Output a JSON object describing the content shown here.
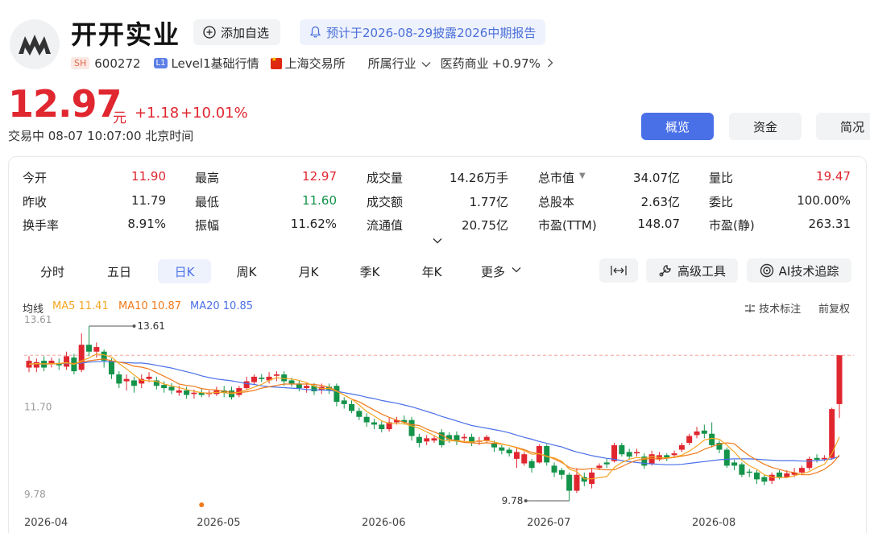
{
  "header": {
    "name": "开开实业",
    "add_watch": "添加自选",
    "notice": "预计于2026-08-29披露2026中期报告",
    "exchange_tag": "SH",
    "code": "600272",
    "level_tag": "L1",
    "level": "Level1基础行情",
    "exchange": "上海交易所",
    "industry_label": "所属行业",
    "industry": "医药商业",
    "industry_change": "+0.97%"
  },
  "quote": {
    "price": "12.97",
    "unit": "元",
    "change": "+1.18",
    "change_pct": "+10.01%",
    "status": "交易中 08-07 10:07:00 北京时间"
  },
  "top_tabs": [
    "概览",
    "资金",
    "简况"
  ],
  "stats": [
    [
      {
        "label": "今开",
        "value": "11.90",
        "color": "red"
      },
      {
        "label": "昨收",
        "value": "11.79",
        "color": ""
      },
      {
        "label": "换手率",
        "value": "8.91%",
        "color": ""
      }
    ],
    [
      {
        "label": "最高",
        "value": "12.97",
        "color": "red"
      },
      {
        "label": "最低",
        "value": "11.60",
        "color": "green"
      },
      {
        "label": "振幅",
        "value": "11.62%",
        "color": ""
      }
    ],
    [
      {
        "label": "成交量",
        "value": "14.26万手",
        "color": ""
      },
      {
        "label": "成交额",
        "value": "1.77亿",
        "color": ""
      },
      {
        "label": "流通值",
        "value": "20.75亿",
        "color": ""
      }
    ],
    [
      {
        "label": "总市值",
        "value": "34.07亿",
        "color": ""
      },
      {
        "label": "总股本",
        "value": "2.63亿",
        "color": ""
      },
      {
        "label": "市盈(TTM)",
        "value": "148.07",
        "color": ""
      }
    ],
    [
      {
        "label": "量比",
        "value": "19.47",
        "color": "red"
      },
      {
        "label": "委比",
        "value": "100.00%",
        "color": ""
      },
      {
        "label": "市盈(静)",
        "value": "263.31",
        "color": ""
      }
    ]
  ],
  "k_tabs": [
    "分时",
    "五日",
    "日K",
    "周K",
    "月K",
    "季K",
    "年K",
    "更多"
  ],
  "tools": {
    "fit": "",
    "advanced": "高级工具",
    "ai": "AI技术追踪"
  },
  "ma_legend": {
    "title": "均线",
    "ma5": "MA5 11.41",
    "ma10": "MA10 10.87",
    "ma20": "MA20 10.85"
  },
  "chart_options": {
    "annotate": "技术标注",
    "adjust": "前复权"
  },
  "colors": {
    "up": "#e0262f",
    "down": "#14934a",
    "ma5": "#f5a623",
    "ma10": "#f07a1a",
    "ma20": "#4a70e8",
    "accent": "#4a70e8"
  },
  "chart_data": {
    "type": "candlestick",
    "y_ticks": [
      "13.61",
      "11.70",
      "9.78"
    ],
    "ylim": [
      9.78,
      13.61
    ],
    "high_label": "13.61",
    "low_label": "9.78",
    "last_close_ref": 12.97,
    "x_ticks": [
      "2026-04",
      "2026-05",
      "2026-06",
      "2026-07",
      "2026-08"
    ],
    "candles": [
      [
        12.7,
        12.85,
        12.95,
        12.6
      ],
      [
        12.7,
        12.82,
        12.9,
        12.6
      ],
      [
        12.85,
        12.7,
        12.95,
        12.62
      ],
      [
        12.78,
        12.85,
        12.92,
        12.7
      ],
      [
        12.8,
        12.75,
        12.9,
        12.65
      ],
      [
        12.72,
        12.95,
        13.05,
        12.65
      ],
      [
        12.92,
        12.62,
        13.0,
        12.55
      ],
      [
        12.65,
        13.2,
        13.45,
        12.6
      ],
      [
        13.2,
        13.05,
        13.61,
        12.95
      ],
      [
        13.05,
        13.15,
        13.25,
        12.92
      ],
      [
        13.05,
        12.85,
        13.1,
        12.7
      ],
      [
        12.85,
        12.55,
        12.9,
        12.45
      ],
      [
        12.55,
        12.35,
        12.62,
        12.25
      ],
      [
        12.4,
        12.45,
        12.55,
        12.2
      ],
      [
        12.42,
        12.3,
        12.5,
        12.15
      ],
      [
        12.35,
        12.45,
        12.55,
        12.25
      ],
      [
        12.45,
        12.5,
        12.6,
        12.38
      ],
      [
        12.42,
        12.3,
        12.5,
        12.22
      ],
      [
        12.32,
        12.25,
        12.4,
        12.15
      ],
      [
        12.28,
        12.2,
        12.36,
        12.12
      ],
      [
        12.15,
        12.2,
        12.3,
        12.08
      ],
      [
        12.2,
        12.1,
        12.28,
        12.02
      ],
      [
        12.12,
        12.15,
        12.22,
        12.02
      ],
      [
        12.15,
        12.1,
        12.25,
        12.05
      ],
      [
        12.12,
        12.15,
        12.2,
        12.05
      ],
      [
        12.12,
        12.2,
        12.28,
        12.08
      ],
      [
        12.2,
        12.15,
        12.3,
        12.05
      ],
      [
        12.2,
        12.05,
        12.28,
        12.0
      ],
      [
        12.1,
        12.25,
        12.3,
        12.05
      ],
      [
        12.25,
        12.4,
        12.5,
        12.2
      ],
      [
        12.38,
        12.5,
        12.55,
        12.32
      ],
      [
        12.48,
        12.45,
        12.56,
        12.38
      ],
      [
        12.42,
        12.5,
        12.6,
        12.35
      ],
      [
        12.52,
        12.55,
        12.62,
        12.4
      ],
      [
        12.55,
        12.4,
        12.62,
        12.3
      ],
      [
        12.42,
        12.35,
        12.48,
        12.28
      ],
      [
        12.35,
        12.25,
        12.42,
        12.18
      ],
      [
        12.25,
        12.3,
        12.38,
        12.15
      ],
      [
        12.3,
        12.18,
        12.36,
        12.1
      ],
      [
        12.2,
        12.28,
        12.35,
        12.12
      ],
      [
        12.28,
        12.2,
        12.35,
        12.12
      ],
      [
        12.3,
        11.95,
        12.35,
        11.85
      ],
      [
        11.98,
        11.9,
        12.05,
        11.8
      ],
      [
        11.9,
        11.75,
        11.98,
        11.7
      ],
      [
        11.75,
        11.62,
        11.82,
        11.55
      ],
      [
        11.62,
        11.5,
        11.7,
        11.4
      ],
      [
        11.5,
        11.45,
        11.58,
        11.35
      ],
      [
        11.45,
        11.35,
        11.52,
        11.28
      ],
      [
        11.35,
        11.5,
        11.6,
        11.3
      ],
      [
        11.5,
        11.55,
        11.62,
        11.45
      ],
      [
        11.55,
        11.5,
        11.65,
        11.45
      ],
      [
        11.55,
        11.2,
        11.62,
        11.1
      ],
      [
        11.18,
        11.05,
        11.25,
        10.95
      ],
      [
        11.08,
        11.15,
        11.22,
        11.0
      ],
      [
        11.1,
        11.15,
        11.2,
        11.05
      ],
      [
        11.28,
        11.0,
        11.35,
        10.95
      ],
      [
        11.22,
        11.12,
        11.28,
        11.05
      ],
      [
        11.22,
        11.08,
        11.3,
        11.0
      ],
      [
        11.15,
        11.18,
        11.25,
        11.08
      ],
      [
        11.18,
        11.05,
        11.25,
        10.98
      ],
      [
        11.08,
        11.1,
        11.18,
        11.0
      ],
      [
        11.1,
        11.18,
        11.22,
        11.05
      ],
      [
        11.05,
        10.95,
        11.1,
        10.85
      ],
      [
        10.95,
        10.88,
        11.0,
        10.8
      ],
      [
        10.9,
        10.82,
        10.95,
        10.75
      ],
      [
        10.7,
        10.85,
        10.95,
        10.5
      ],
      [
        10.6,
        10.8,
        10.85,
        10.55
      ],
      [
        10.65,
        10.5,
        10.7,
        10.4
      ],
      [
        10.62,
        10.98,
        11.02,
        10.6
      ],
      [
        10.98,
        10.62,
        11.02,
        10.55
      ],
      [
        10.55,
        10.4,
        10.62,
        10.3
      ],
      [
        10.45,
        10.35,
        10.5,
        10.25
      ],
      [
        10.35,
        10.0,
        10.4,
        9.78
      ],
      [
        10.0,
        10.35,
        10.5,
        9.95
      ],
      [
        10.3,
        10.2,
        10.4,
        10.1
      ],
      [
        10.15,
        10.4,
        10.5,
        10.05
      ],
      [
        10.5,
        10.55,
        10.6,
        10.45
      ],
      [
        10.62,
        10.58,
        10.7,
        10.5
      ],
      [
        10.65,
        11.0,
        11.05,
        10.62
      ],
      [
        11.0,
        10.8,
        11.05,
        10.75
      ],
      [
        10.85,
        10.75,
        10.92,
        10.7
      ],
      [
        10.82,
        10.85,
        10.92,
        10.75
      ],
      [
        10.75,
        10.55,
        10.82,
        10.48
      ],
      [
        10.6,
        10.8,
        10.88,
        10.55
      ],
      [
        10.7,
        10.78,
        10.85,
        10.65
      ],
      [
        10.78,
        10.72,
        10.82,
        10.65
      ],
      [
        10.78,
        10.82,
        10.88,
        10.72
      ],
      [
        10.9,
        11.0,
        11.05,
        10.85
      ],
      [
        11.05,
        11.2,
        11.25,
        11.0
      ],
      [
        11.22,
        11.3,
        11.4,
        11.15
      ],
      [
        11.32,
        11.25,
        11.45,
        11.15
      ],
      [
        11.25,
        11.0,
        11.5,
        10.95
      ],
      [
        11.05,
        10.9,
        11.1,
        10.82
      ],
      [
        10.9,
        10.55,
        10.95,
        10.5
      ],
      [
        10.62,
        10.55,
        10.68,
        10.45
      ],
      [
        10.58,
        10.35,
        10.62,
        10.3
      ],
      [
        10.42,
        10.4,
        10.48,
        10.3
      ],
      [
        10.4,
        10.25,
        10.45,
        10.15
      ],
      [
        10.3,
        10.2,
        10.35,
        10.12
      ],
      [
        10.22,
        10.35,
        10.4,
        10.15
      ],
      [
        10.4,
        10.3,
        10.45,
        10.25
      ],
      [
        10.3,
        10.38,
        10.45,
        10.28
      ],
      [
        10.35,
        10.4,
        10.5,
        10.3
      ],
      [
        10.4,
        10.5,
        10.55,
        10.35
      ],
      [
        10.5,
        10.7,
        10.75,
        10.45
      ],
      [
        10.72,
        10.68,
        10.8,
        10.62
      ],
      [
        10.7,
        10.72,
        10.78,
        10.65
      ],
      [
        10.72,
        11.79,
        11.82,
        10.68
      ],
      [
        11.9,
        12.97,
        12.97,
        11.6
      ]
    ],
    "ma5": [
      12.77,
      12.79,
      12.78,
      12.78,
      12.79,
      12.81,
      12.77,
      12.85,
      12.91,
      13.0,
      12.98,
      12.93,
      12.79,
      12.67,
      12.54,
      12.42,
      12.41,
      12.4,
      12.34,
      12.3,
      12.26,
      12.22,
      12.18,
      12.15,
      12.14,
      12.16,
      12.15,
      12.13,
      12.16,
      12.21,
      12.27,
      12.33,
      12.42,
      12.48,
      12.46,
      12.45,
      12.42,
      12.37,
      12.29,
      12.24,
      12.24,
      12.18,
      12.1,
      12.01,
      11.88,
      11.74,
      11.64,
      11.53,
      11.48,
      11.47,
      11.47,
      11.42,
      11.37,
      11.29,
      11.21,
      11.11,
      11.09,
      11.1,
      11.08,
      11.07,
      11.09,
      11.1,
      11.07,
      11.03,
      10.99,
      10.94,
      10.88,
      10.8,
      10.81,
      10.75,
      10.72,
      10.65,
      10.47,
      10.42,
      10.26,
      10.26,
      10.29,
      10.31,
      10.51,
      10.62,
      10.69,
      10.73,
      10.71,
      10.75,
      10.73,
      10.72,
      10.74,
      10.78,
      10.87,
      10.98,
      11.11,
      11.15,
      11.13,
      11.0,
      10.85,
      10.67,
      10.55,
      10.47,
      10.35,
      10.3,
      10.29,
      10.29,
      10.33,
      10.37,
      10.42,
      10.51,
      10.58,
      10.81,
      11.18
    ],
    "ma10": [
      12.78,
      12.78,
      12.78,
      12.79,
      12.79,
      12.8,
      12.79,
      12.82,
      12.85,
      12.87,
      12.89,
      12.85,
      12.82,
      12.79,
      12.73,
      12.71,
      12.67,
      12.59,
      12.51,
      12.43,
      12.34,
      12.31,
      12.29,
      12.24,
      12.22,
      12.21,
      12.18,
      12.16,
      12.15,
      12.17,
      12.2,
      12.25,
      12.28,
      12.31,
      12.34,
      12.34,
      12.34,
      12.34,
      12.33,
      12.31,
      12.27,
      12.19,
      12.1,
      12.01,
      11.95,
      11.86,
      11.77,
      11.68,
      11.61,
      11.55,
      11.5,
      11.45,
      11.43,
      11.35,
      11.29,
      11.22,
      11.13,
      11.09,
      11.06,
      11.05,
      11.04,
      11.05,
      11.04,
      11.02,
      10.99,
      10.95,
      10.9,
      10.84,
      10.81,
      10.76,
      10.7,
      10.62,
      10.51,
      10.47,
      10.47,
      10.49,
      10.47,
      10.46,
      10.46,
      10.53,
      10.61,
      10.67,
      10.69,
      10.71,
      10.69,
      10.71,
      10.73,
      10.76,
      10.79,
      10.83,
      10.91,
      10.97,
      11.02,
      11.05,
      11.03,
      10.89,
      10.77,
      10.67,
      10.58,
      10.51,
      10.47,
      10.42,
      10.4,
      10.35,
      10.35,
      10.4,
      10.47,
      10.59,
      10.78
    ],
    "ma20": [
      12.78,
      12.78,
      12.78,
      12.78,
      12.79,
      12.79,
      12.79,
      12.8,
      12.82,
      12.83,
      12.83,
      12.83,
      12.82,
      12.81,
      12.8,
      12.8,
      12.78,
      12.75,
      12.72,
      12.69,
      12.65,
      12.61,
      12.57,
      12.52,
      12.48,
      12.45,
      12.43,
      12.41,
      12.38,
      12.35,
      12.33,
      12.3,
      12.28,
      12.27,
      12.26,
      12.25,
      12.24,
      12.22,
      12.21,
      12.21,
      12.2,
      12.18,
      12.15,
      12.12,
      12.09,
      12.05,
      12.02,
      11.98,
      11.95,
      11.92,
      11.88,
      11.84,
      11.79,
      11.74,
      11.69,
      11.63,
      11.58,
      11.53,
      11.48,
      11.43,
      11.4,
      11.37,
      11.34,
      11.31,
      11.27,
      11.22,
      11.17,
      11.13,
      11.08,
      11.04,
      11.0,
      10.96,
      10.9,
      10.85,
      10.81,
      10.77,
      10.74,
      10.71,
      10.69,
      10.66,
      10.64,
      10.62,
      10.6,
      10.59,
      10.58,
      10.57,
      10.57,
      10.58,
      10.6,
      10.62,
      10.64,
      10.66,
      10.68,
      10.69,
      10.7,
      10.7,
      10.7,
      10.69,
      10.68,
      10.67,
      10.66,
      10.66,
      10.66,
      10.65,
      10.65,
      10.66,
      10.68,
      10.7,
      10.75
    ]
  }
}
